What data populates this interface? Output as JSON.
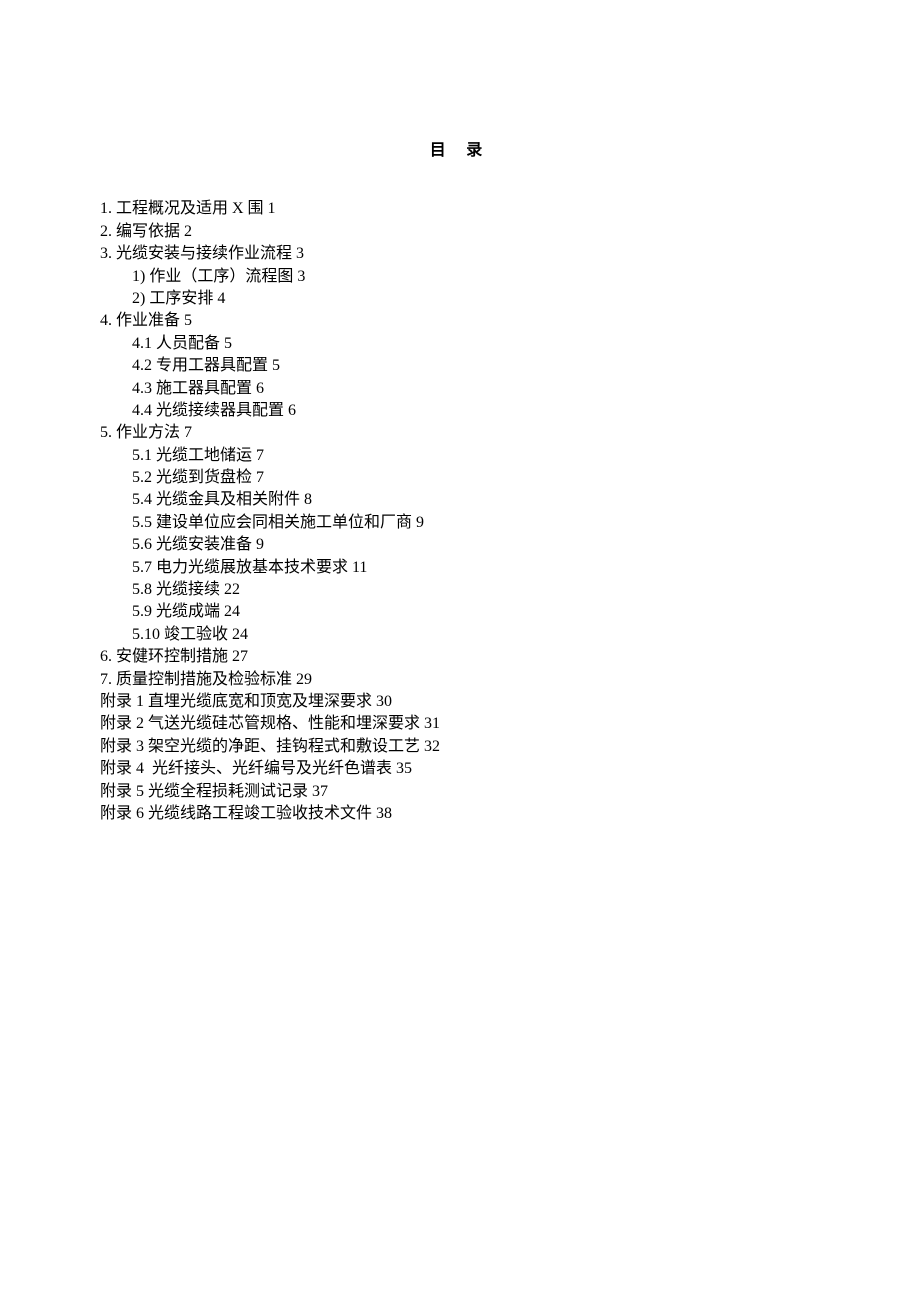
{
  "title": "目 录",
  "toc": [
    {
      "indent": 0,
      "text": "1. 工程概况及适用 X 围 1"
    },
    {
      "indent": 0,
      "text": "2. 编写依据 2"
    },
    {
      "indent": 0,
      "text": "3. 光缆安装与接续作业流程 3"
    },
    {
      "indent": 1,
      "text": "1) 作业（工序）流程图 3"
    },
    {
      "indent": 1,
      "text": "2) 工序安排 4"
    },
    {
      "indent": 0,
      "text": "4. 作业准备 5"
    },
    {
      "indent": 1,
      "text": "4.1 人员配备 5"
    },
    {
      "indent": 1,
      "text": "4.2 专用工器具配置 5"
    },
    {
      "indent": 1,
      "text": "4.3 施工器具配置 6"
    },
    {
      "indent": 1,
      "text": "4.4 光缆接续器具配置 6"
    },
    {
      "indent": 0,
      "text": "5. 作业方法 7"
    },
    {
      "indent": 1,
      "text": "5.1 光缆工地储运 7"
    },
    {
      "indent": 1,
      "text": "5.2 光缆到货盘检 7"
    },
    {
      "indent": 1,
      "text": "5.4 光缆金具及相关附件 8"
    },
    {
      "indent": 1,
      "text": "5.5 建设单位应会同相关施工单位和厂商 9"
    },
    {
      "indent": 1,
      "text": "5.6 光缆安装准备 9"
    },
    {
      "indent": 1,
      "text": "5.7 电力光缆展放基本技术要求 11"
    },
    {
      "indent": 1,
      "text": "5.8 光缆接续 22"
    },
    {
      "indent": 1,
      "text": "5.9 光缆成端 24"
    },
    {
      "indent": 1,
      "text": "5.10 竣工验收 24"
    },
    {
      "indent": 0,
      "text": "6. 安健环控制措施 27"
    },
    {
      "indent": 0,
      "text": "7. 质量控制措施及检验标准 29"
    },
    {
      "indent": 0,
      "text": "附录 1 直埋光缆底宽和顶宽及埋深要求 30"
    },
    {
      "indent": 0,
      "text": "附录 2 气送光缆硅芯管规格、性能和埋深要求 31"
    },
    {
      "indent": 0,
      "text": "附录 3 架空光缆的净距、挂钩程式和敷设工艺 32"
    },
    {
      "indent": 0,
      "text": "附录 4  光纤接头、光纤编号及光纤色谱表 35"
    },
    {
      "indent": 0,
      "text": "附录 5 光缆全程损耗测试记录 37"
    },
    {
      "indent": 0,
      "text": "附录 6 光缆线路工程竣工验收技术文件 38"
    }
  ]
}
